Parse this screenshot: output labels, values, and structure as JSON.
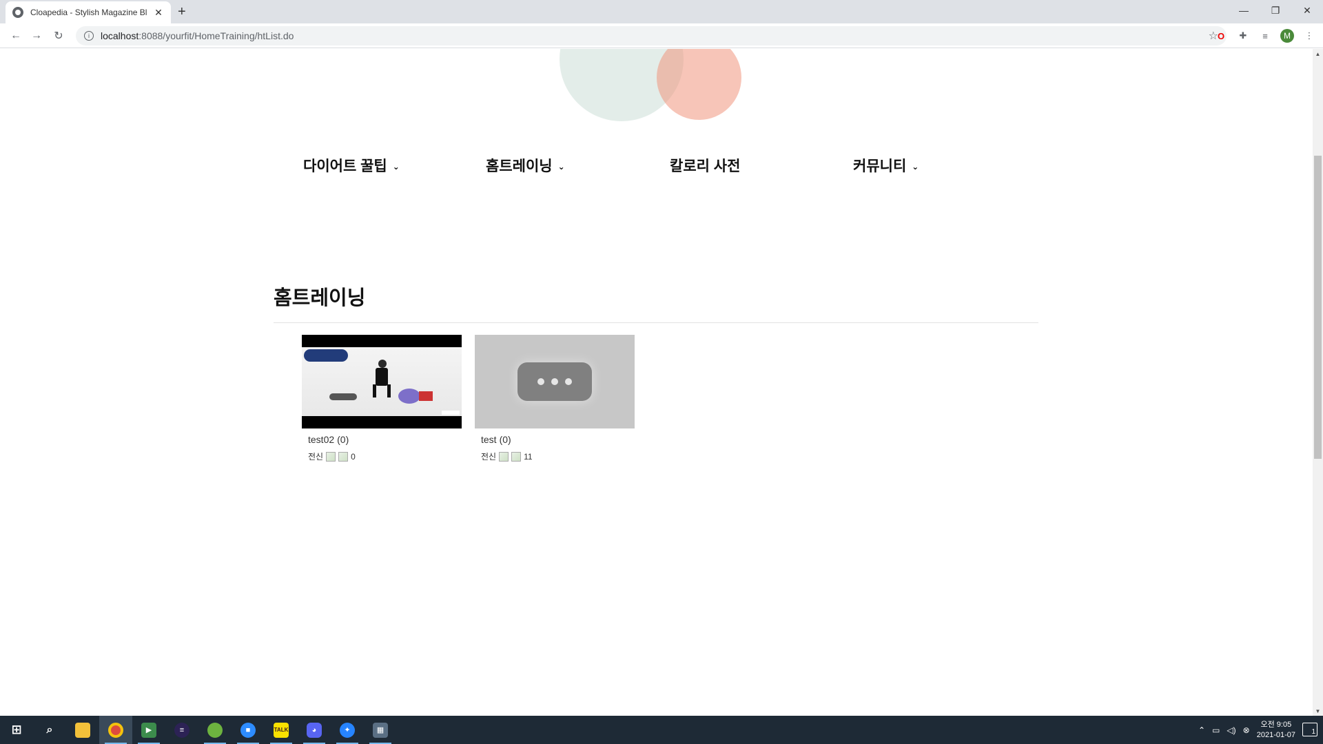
{
  "browser": {
    "tab_title": "Cloapedia - Stylish Magazine Bl",
    "tab_close": "✕",
    "new_tab": "+",
    "url_host": "localhost",
    "url_path": ":8088/yourfit/HomeTraining/htList.do",
    "profile_initial": "M",
    "window_controls": {
      "minimize": "—",
      "restore": "❐",
      "close": "✕"
    }
  },
  "site": {
    "menu": [
      {
        "label": "다이어트 꿀팁",
        "has_dropdown": true
      },
      {
        "label": "홈트레이닝",
        "has_dropdown": true
      },
      {
        "label": "칼로리 사전",
        "has_dropdown": false
      },
      {
        "label": "커뮤니티",
        "has_dropdown": true
      }
    ],
    "dropdown_glyph": "⌄",
    "section_title": "홈트레이닝",
    "cards": [
      {
        "title": "test02",
        "count": "(0)",
        "category": "전신",
        "views": "0",
        "thumbnail": "workout-video"
      },
      {
        "title": "test",
        "count": "(0)",
        "category": "전신",
        "views": "11",
        "thumbnail": "video-unavailable"
      }
    ]
  },
  "taskbar": {
    "clock_line1": "오전 9:05",
    "clock_line2": "2021-01-07",
    "notification_count": "1",
    "apps": [
      "start",
      "search",
      "file-explorer",
      "chrome",
      "media-player",
      "eclipse",
      "spring-tools",
      "zoom",
      "kakaotalk",
      "discord",
      "sourcetree",
      "calculator"
    ],
    "kakao_label": "TALK"
  },
  "colors": {
    "accent_circle_green": "#c8dcd4",
    "accent_circle_salmon": "#f0967d",
    "taskbar_bg": "#1e2a36"
  }
}
